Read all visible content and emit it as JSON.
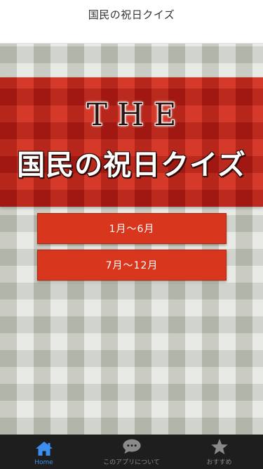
{
  "header": {
    "title": "国民の祝日クイズ"
  },
  "banner": {
    "the": "THE",
    "title": "国民の祝日クイズ"
  },
  "buttons": [
    {
      "label": "1月〜6月"
    },
    {
      "label": "7月〜12月"
    }
  ],
  "tabs": [
    {
      "label": "Home",
      "icon": "home-icon",
      "active": true
    },
    {
      "label": "このアプリについて",
      "icon": "speech-bubble-icon",
      "active": false
    },
    {
      "label": "おすすめ",
      "icon": "star-icon",
      "active": false
    }
  ],
  "colors": {
    "banner_red": "#c8261a",
    "button_red": "#d9371d",
    "tab_bar": "#1e1e1e",
    "tab_active": "#3c8ef1",
    "tab_inactive": "#8a8a8a"
  }
}
